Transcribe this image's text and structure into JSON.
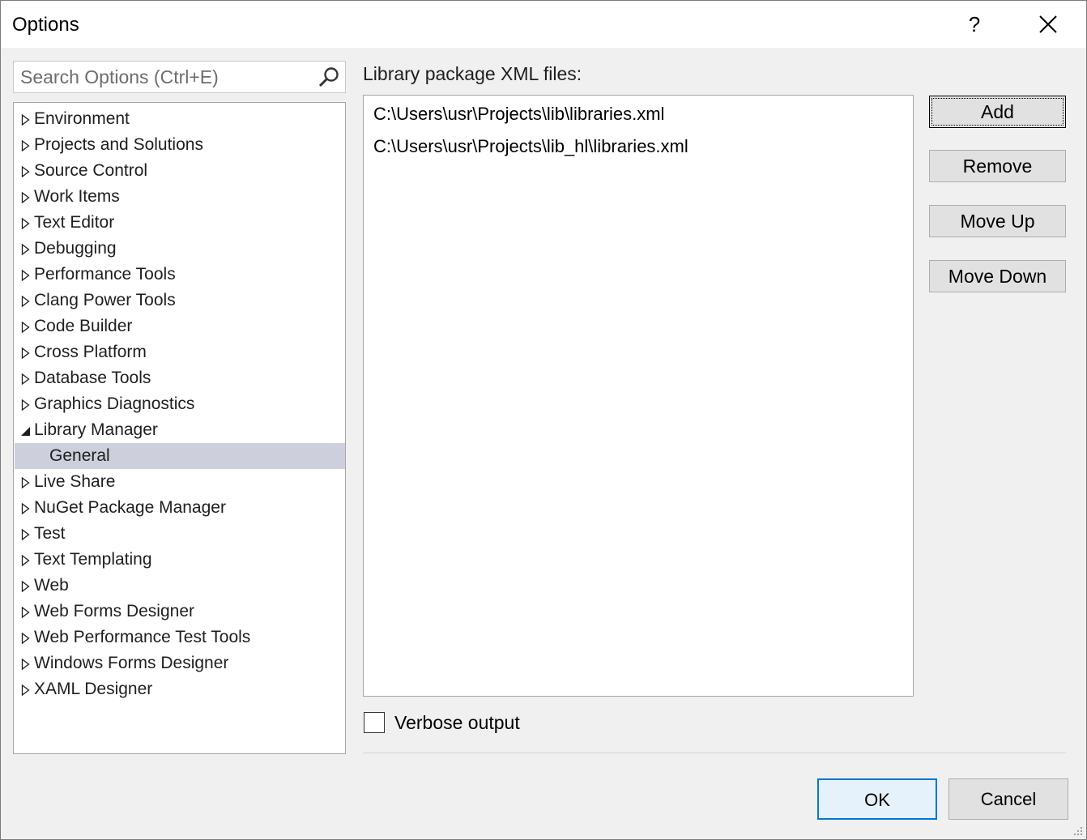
{
  "window": {
    "title": "Options",
    "help_label": "?"
  },
  "search": {
    "placeholder": "Search Options (Ctrl+E)"
  },
  "tree": {
    "items": [
      {
        "label": "Environment",
        "state": "collapsed"
      },
      {
        "label": "Projects and Solutions",
        "state": "collapsed"
      },
      {
        "label": "Source Control",
        "state": "collapsed"
      },
      {
        "label": "Work Items",
        "state": "collapsed"
      },
      {
        "label": "Text Editor",
        "state": "collapsed"
      },
      {
        "label": "Debugging",
        "state": "collapsed"
      },
      {
        "label": "Performance Tools",
        "state": "collapsed"
      },
      {
        "label": "Clang Power Tools",
        "state": "collapsed"
      },
      {
        "label": "Code Builder",
        "state": "collapsed"
      },
      {
        "label": "Cross Platform",
        "state": "collapsed"
      },
      {
        "label": "Database Tools",
        "state": "collapsed"
      },
      {
        "label": "Graphics Diagnostics",
        "state": "collapsed"
      },
      {
        "label": "Library Manager",
        "state": "expanded"
      },
      {
        "label": "General",
        "state": "child-selected"
      },
      {
        "label": "Live Share",
        "state": "collapsed"
      },
      {
        "label": "NuGet Package Manager",
        "state": "collapsed"
      },
      {
        "label": "Test",
        "state": "collapsed"
      },
      {
        "label": "Text Templating",
        "state": "collapsed"
      },
      {
        "label": "Web",
        "state": "collapsed"
      },
      {
        "label": "Web Forms Designer",
        "state": "collapsed"
      },
      {
        "label": "Web Performance Test Tools",
        "state": "collapsed"
      },
      {
        "label": "Windows Forms Designer",
        "state": "collapsed"
      },
      {
        "label": "XAML Designer",
        "state": "collapsed"
      }
    ]
  },
  "panel": {
    "list_label": "Library package XML files:",
    "files": [
      "C:\\Users\\usr\\Projects\\lib\\libraries.xml",
      "C:\\Users\\usr\\Projects\\lib_hl\\libraries.xml"
    ],
    "buttons": {
      "add": "Add",
      "remove": "Remove",
      "move_up": "Move Up",
      "move_down": "Move Down"
    },
    "verbose_label": "Verbose output",
    "verbose_checked": false
  },
  "footer": {
    "ok": "OK",
    "cancel": "Cancel"
  },
  "colors": {
    "selection": "#cdd0dc",
    "ok_border": "#0078d7",
    "ok_fill": "#e5f1fb"
  },
  "icons": {
    "search": "magnifier-icon",
    "close": "close-x-icon",
    "collapsed": "triangle-right-outline-icon",
    "expanded": "triangle-down-filled-icon"
  }
}
